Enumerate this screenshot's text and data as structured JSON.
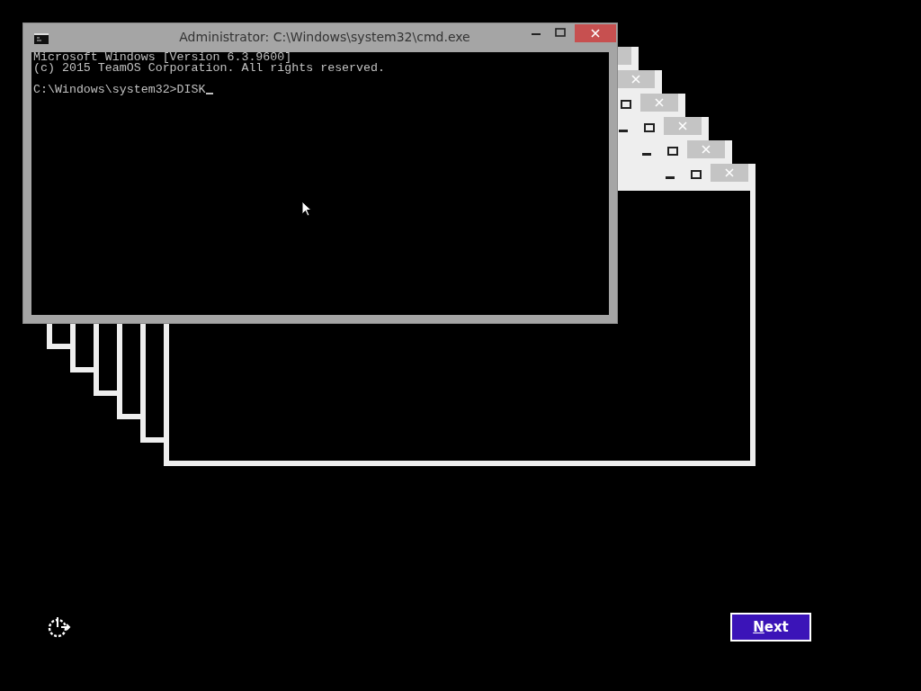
{
  "ghost_windows": [
    {
      "kind": "window"
    },
    {
      "kind": "window"
    },
    {
      "kind": "window"
    },
    {
      "kind": "window"
    },
    {
      "kind": "window"
    },
    {
      "kind": "window"
    }
  ],
  "window": {
    "title": "Administrator: C:\\Windows\\system32\\cmd.exe"
  },
  "console": {
    "lines": [
      "Microsoft Windows [Version 6.3.9600]",
      "(c) 2015 TeamOS Corporation. All rights reserved."
    ],
    "prompt": "C:\\Windows\\system32>DISK"
  },
  "next_button": {
    "label": "Next"
  }
}
